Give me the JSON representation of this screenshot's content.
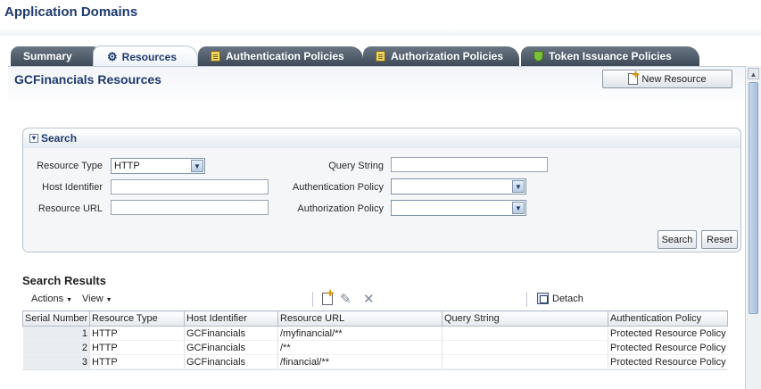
{
  "app": {
    "title": "Application Domains"
  },
  "tabs": [
    {
      "label": "Summary",
      "icon": "none"
    },
    {
      "label": "Resources",
      "icon": "gear-icon",
      "active": true
    },
    {
      "label": "Authentication Policies",
      "icon": "policy-doc-icon"
    },
    {
      "label": "Authorization Policies",
      "icon": "policy-doc-icon"
    },
    {
      "label": "Token Issuance Policies",
      "icon": "shield-check-icon"
    }
  ],
  "page": {
    "title": "GCFinancials Resources",
    "new_resource_label": "New Resource"
  },
  "search": {
    "title": "Search",
    "resource_type_label": "Resource Type",
    "resource_type_value": "HTTP",
    "host_identifier_label": "Host Identifier",
    "host_identifier_value": "",
    "resource_url_label": "Resource URL",
    "resource_url_value": "",
    "query_string_label": "Query String",
    "query_string_value": "",
    "authentication_policy_label": "Authentication Policy",
    "authentication_policy_value": "",
    "authorization_policy_label": "Authorization Policy",
    "authorization_policy_value": "",
    "search_button": "Search",
    "reset_button": "Reset"
  },
  "results": {
    "title": "Search Results",
    "actions_label": "Actions",
    "view_label": "View",
    "detach_label": "Detach",
    "columns": [
      "Serial Number",
      "Resource Type",
      "Host Identifier",
      "Resource URL",
      "Query String",
      "Authentication Policy"
    ],
    "rows": [
      {
        "serial": "1",
        "type": "HTTP",
        "host": "GCFinancials",
        "url": "/myfinancial/**",
        "query": "",
        "auth_policy": "Protected Resource Policy"
      },
      {
        "serial": "2",
        "type": "HTTP",
        "host": "GCFinancials",
        "url": "/**",
        "query": "",
        "auth_policy": "Protected Resource Policy"
      },
      {
        "serial": "3",
        "type": "HTTP",
        "host": "GCFinancials",
        "url": "/financial/**",
        "query": "",
        "auth_policy": "Protected Resource Policy"
      }
    ]
  },
  "colors": {
    "title_blue": "#1e3a6e",
    "tab_dark": "#4a5664",
    "panel_bg": "#f4f6f8"
  }
}
